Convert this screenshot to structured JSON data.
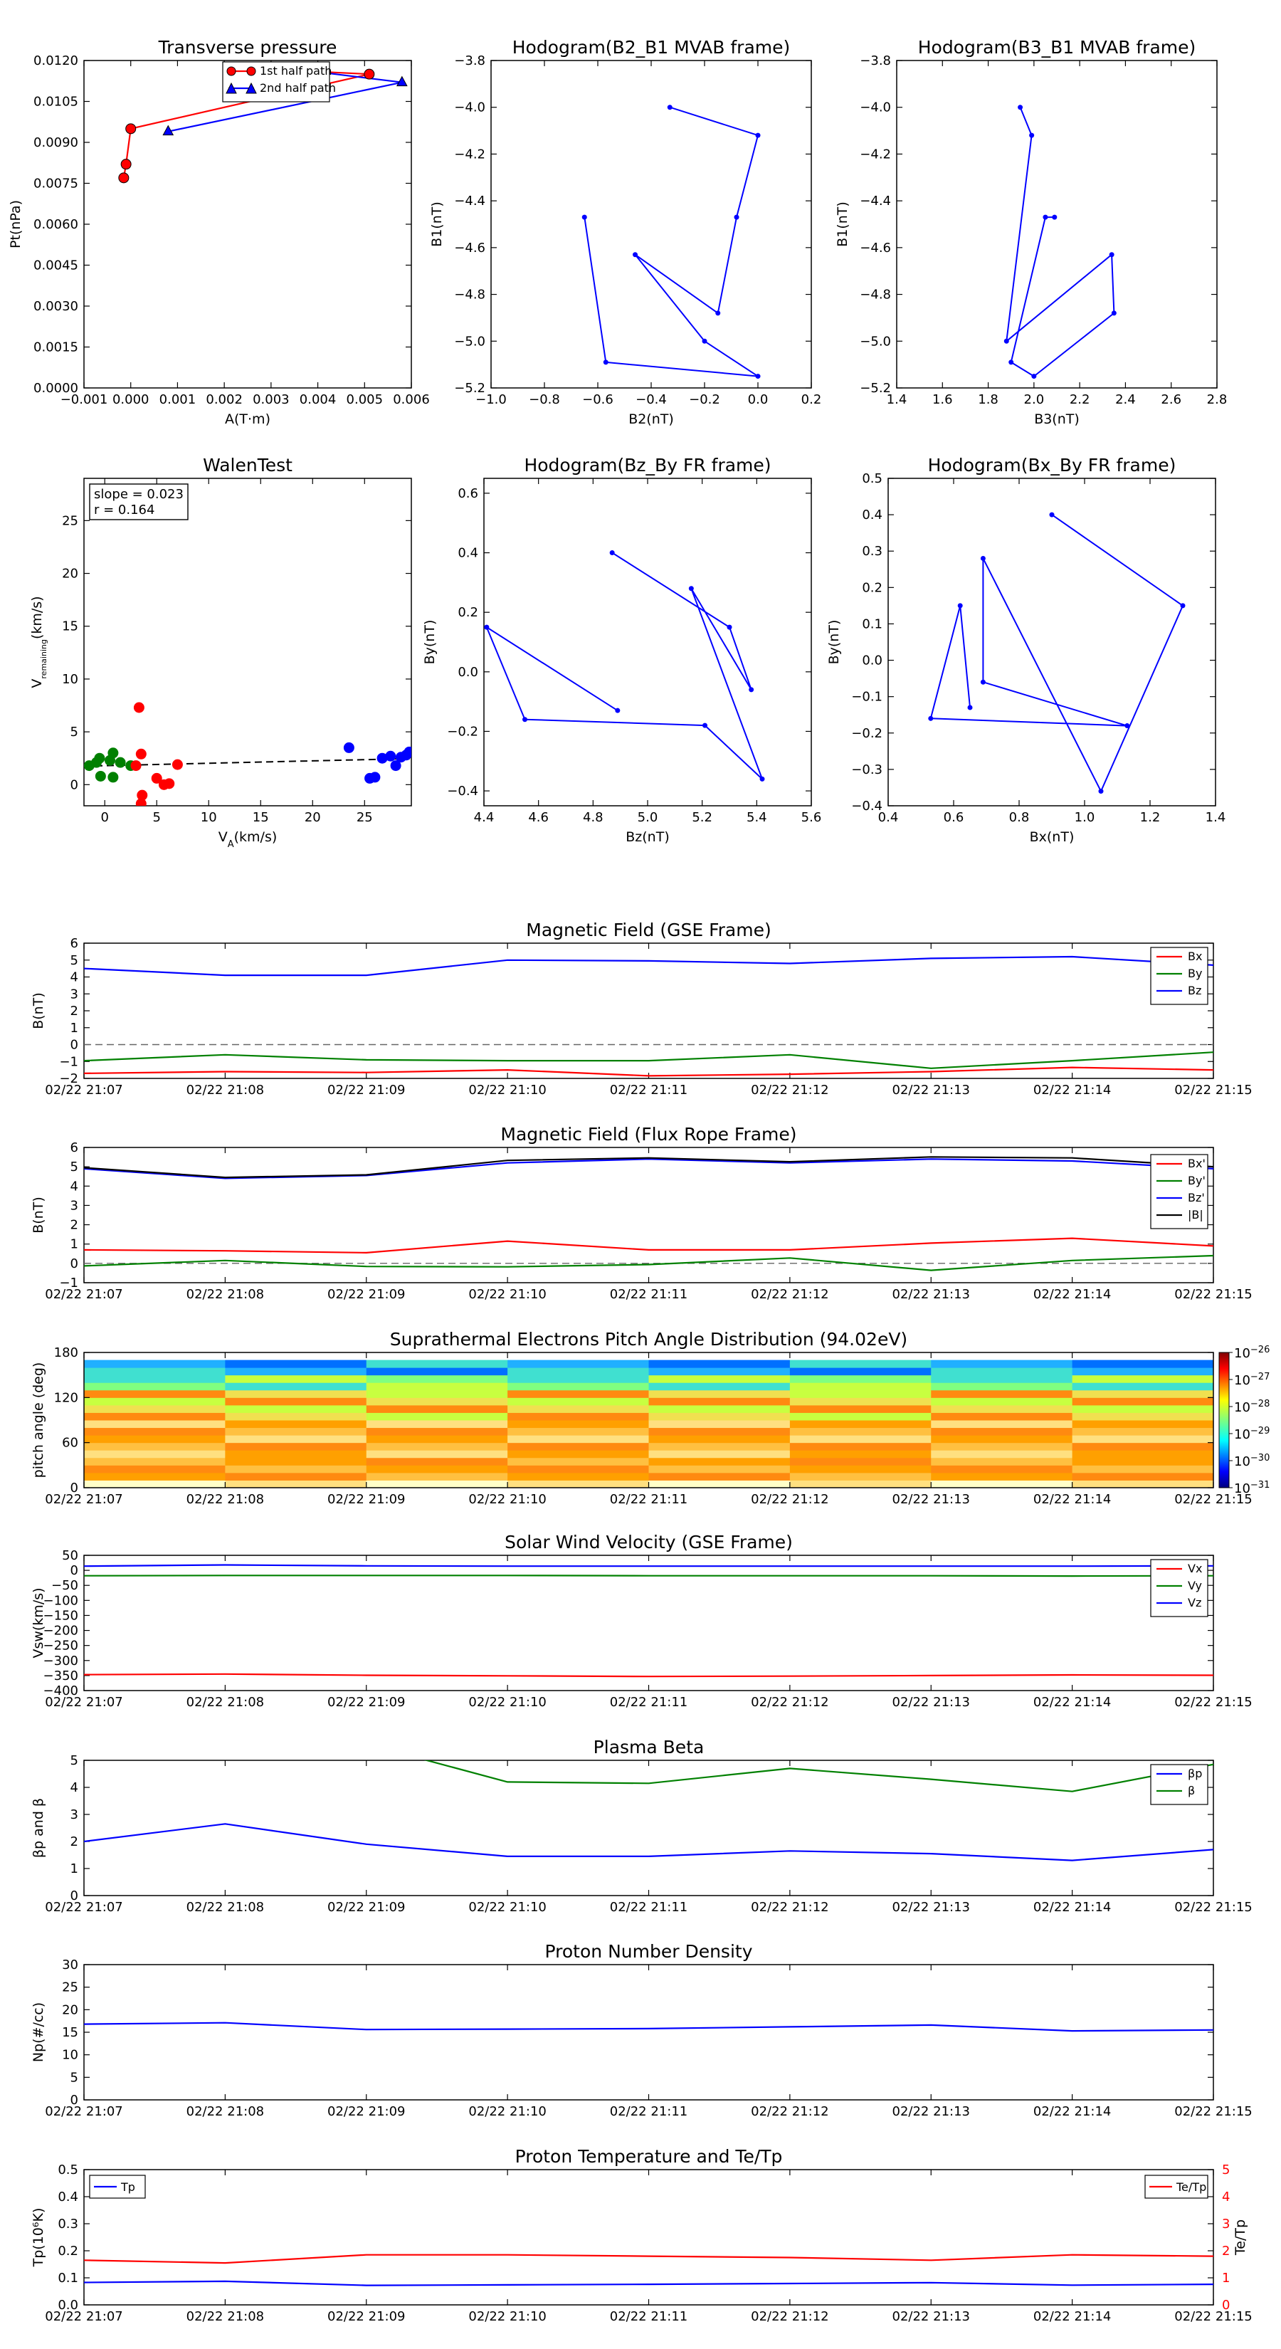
{
  "chart_data": [
    {
      "id": "pt",
      "type": "line",
      "title": "Transverse pressure",
      "xlabel": "A(T·m)",
      "ylabel": "Pt(nPa)",
      "xlim": [
        -0.001,
        0.006
      ],
      "ylim": [
        0,
        0.012
      ],
      "xticks": [
        -0.001,
        0,
        0.001,
        0.002,
        0.003,
        0.004,
        0.005,
        0.006
      ],
      "yticks": [
        0,
        0.0015,
        0.003,
        0.0045,
        0.006,
        0.0075,
        0.009,
        0.0105,
        0.012
      ],
      "xtick_labels": [
        "−0.001",
        "0.000",
        "0.001",
        "0.002",
        "0.003",
        "0.004",
        "0.005",
        "0.006"
      ],
      "ytick_labels": [
        "0.0000",
        "0.0015",
        "0.0030",
        "0.0045",
        "0.0060",
        "0.0075",
        "0.0090",
        "0.0105",
        "0.0120"
      ],
      "legend": "top-center",
      "series": [
        {
          "name": "1st half path",
          "color": "#ff0000",
          "marker": "circle",
          "x": [
            -0.00015,
            -0.0001,
            0.0,
            0.0051,
            0.0039
          ],
          "y": [
            0.0077,
            0.0082,
            0.0095,
            0.0115,
            0.0116
          ]
        },
        {
          "name": "2nd half path",
          "color": "#0000ff",
          "marker": "triangle",
          "x": [
            0.0039,
            0.0058,
            0.0008
          ],
          "y": [
            0.0116,
            0.0112,
            0.0094
          ]
        }
      ]
    },
    {
      "id": "h21",
      "type": "line",
      "title": "Hodogram(B2_B1 MVAB frame)",
      "xlabel": "B2(nT)",
      "ylabel": "B1(nT)",
      "xlim": [
        -1.0,
        0.2
      ],
      "ylim": [
        -5.2,
        -3.8
      ],
      "xticks": [
        -1.0,
        -0.8,
        -0.6,
        -0.4,
        -0.2,
        0.0,
        0.2
      ],
      "yticks": [
        -5.2,
        -5.0,
        -4.8,
        -4.6,
        -4.4,
        -4.2,
        -4.0,
        -3.8
      ],
      "xtick_labels": [
        "−1.0",
        "−0.8",
        "−0.6",
        "−0.4",
        "−0.2",
        "0.0",
        "0.2"
      ],
      "ytick_labels": [
        "−5.2",
        "−5.0",
        "−4.8",
        "−4.6",
        "−4.4",
        "−4.2",
        "−4.0",
        "−3.8"
      ],
      "series": [
        {
          "color": "#0000ff",
          "x": [
            -0.65,
            -0.57,
            0.0,
            -0.2,
            -0.46,
            -0.15,
            -0.08,
            0.0,
            -0.33
          ],
          "y": [
            -4.47,
            -5.09,
            -5.15,
            -5.0,
            -4.63,
            -4.88,
            -4.47,
            -4.12,
            -4.0
          ]
        }
      ]
    },
    {
      "id": "h31",
      "type": "line",
      "title": "Hodogram(B3_B1 MVAB frame)",
      "xlabel": "B3(nT)",
      "ylabel": "B1(nT)",
      "xlim": [
        1.4,
        2.8
      ],
      "ylim": [
        -5.2,
        -3.8
      ],
      "xticks": [
        1.4,
        1.6,
        1.8,
        2.0,
        2.2,
        2.4,
        2.6,
        2.8
      ],
      "yticks": [
        -5.2,
        -5.0,
        -4.8,
        -4.6,
        -4.4,
        -4.2,
        -4.0,
        -3.8
      ],
      "xtick_labels": [
        "1.4",
        "1.6",
        "1.8",
        "2.0",
        "2.2",
        "2.4",
        "2.6",
        "2.8"
      ],
      "ytick_labels": [
        "−5.2",
        "−5.0",
        "−4.8",
        "−4.6",
        "−4.4",
        "−4.2",
        "−4.0",
        "−3.8"
      ],
      "series": [
        {
          "color": "#0000ff",
          "x": [
            2.09,
            2.05,
            1.9,
            2.0,
            2.35,
            2.34,
            1.88,
            1.99,
            1.94
          ],
          "y": [
            -4.47,
            -4.47,
            -5.09,
            -5.15,
            -4.88,
            -4.63,
            -5.0,
            -4.12,
            -4.0
          ]
        }
      ]
    },
    {
      "id": "walen",
      "type": "scatter",
      "title": "WalenTest",
      "xlabel": "V",
      "xlabel_sub": "A",
      "xlabel_unit": "(km/s)",
      "ylabel": "V",
      "ylabel_sub": "remaining",
      "ylabel_unit": "(km/s)",
      "xlim": [
        -2,
        29.5
      ],
      "ylim": [
        -2,
        29
      ],
      "xticks": [
        0,
        5,
        10,
        15,
        20,
        25
      ],
      "yticks": [
        0,
        5,
        10,
        15,
        20,
        25
      ],
      "xtick_labels": [
        "0",
        "5",
        "10",
        "15",
        "20",
        "25"
      ],
      "ytick_labels": [
        "0",
        "5",
        "10",
        "15",
        "20",
        "25"
      ],
      "annotation": [
        "slope = 0.023",
        "r = 0.164"
      ],
      "fit": {
        "x": [
          -2,
          29.5
        ],
        "y": [
          1.75,
          2.47
        ]
      },
      "groups": [
        {
          "color": "#008000",
          "x": [
            -1.5,
            -0.8,
            -0.5,
            0.5,
            0.8,
            1.5,
            2.5,
            -0.4,
            0.8
          ],
          "y": [
            1.8,
            2.1,
            2.5,
            2.3,
            3.0,
            2.1,
            1.8,
            0.8,
            0.7
          ]
        },
        {
          "color": "#ff0000",
          "x": [
            3.3,
            3.5,
            3.6,
            3.5,
            5.0,
            5.7,
            6.2,
            7.0,
            3.0
          ],
          "y": [
            7.3,
            2.9,
            -1.0,
            -1.8,
            0.6,
            0.0,
            0.1,
            1.9,
            1.8
          ]
        },
        {
          "color": "#0000ff",
          "x": [
            23.5,
            25.5,
            26.0,
            26.7,
            27.5,
            28.0,
            28.5,
            29.0,
            29.3
          ],
          "y": [
            3.5,
            0.6,
            0.7,
            2.5,
            2.7,
            1.8,
            2.6,
            2.8,
            3.1
          ]
        }
      ]
    },
    {
      "id": "hzy",
      "type": "line",
      "title": "Hodogram(Bz_By FR frame)",
      "xlabel": "Bz(nT)",
      "ylabel": "By(nT)",
      "xlim": [
        4.4,
        5.6
      ],
      "ylim": [
        -0.45,
        0.65
      ],
      "xticks": [
        4.4,
        4.6,
        4.8,
        5.0,
        5.2,
        5.4,
        5.6
      ],
      "yticks": [
        -0.4,
        -0.2,
        0.0,
        0.2,
        0.4,
        0.6
      ],
      "xtick_labels": [
        "4.4",
        "4.6",
        "4.8",
        "5.0",
        "5.2",
        "5.4",
        "5.6"
      ],
      "ytick_labels": [
        "−0.4",
        "−0.2",
        "0.0",
        "0.2",
        "0.4",
        "0.6"
      ],
      "series": [
        {
          "color": "#0000ff",
          "x": [
            4.87,
            5.3,
            5.38,
            5.16,
            5.42,
            5.21,
            4.55,
            4.41,
            4.89
          ],
          "y": [
            0.4,
            0.15,
            -0.06,
            0.28,
            -0.36,
            -0.18,
            -0.16,
            0.15,
            -0.13
          ]
        }
      ]
    },
    {
      "id": "hxy",
      "type": "line",
      "title": "Hodogram(Bx_By FR frame)",
      "xlabel": "Bx(nT)",
      "ylabel": "By(nT)",
      "xlim": [
        0.4,
        1.4
      ],
      "ylim": [
        -0.4,
        0.5
      ],
      "xticks": [
        0.4,
        0.6,
        0.8,
        1.0,
        1.2,
        1.4
      ],
      "yticks": [
        -0.4,
        -0.3,
        -0.2,
        -0.1,
        0.0,
        0.1,
        0.2,
        0.3,
        0.4,
        0.5
      ],
      "xtick_labels": [
        "0.4",
        "0.6",
        "0.8",
        "1.0",
        "1.2",
        "1.4"
      ],
      "ytick_labels": [
        "−0.4",
        "−0.3",
        "−0.2",
        "−0.1",
        "0.0",
        "0.1",
        "0.2",
        "0.3",
        "0.4",
        "0.5"
      ],
      "series": [
        {
          "color": "#0000ff",
          "x": [
            0.9,
            1.3,
            1.05,
            0.69,
            0.69,
            1.13,
            0.53,
            0.62,
            0.65
          ],
          "y": [
            0.4,
            0.15,
            -0.36,
            0.28,
            -0.06,
            -0.18,
            -0.16,
            0.15,
            -0.13
          ]
        }
      ]
    },
    {
      "id": "bgse",
      "type": "line",
      "title": "Magnetic Field (GSE Frame)",
      "ylabel": "B(nT)",
      "x": [
        0,
        1,
        2,
        3,
        4,
        5,
        6,
        7,
        8
      ],
      "xtick_labels": [
        "02/22 21:07",
        "02/22 21:08",
        "02/22 21:09",
        "02/22 21:10",
        "02/22 21:11",
        "02/22 21:12",
        "02/22 21:13",
        "02/22 21:14",
        "02/22 21:15"
      ],
      "ylim": [
        -2,
        6
      ],
      "yticks": [
        -2,
        -1,
        0,
        1,
        2,
        3,
        4,
        5,
        6
      ],
      "ytick_labels": [
        "−2",
        "−1",
        "0",
        "1",
        "2",
        "3",
        "4",
        "5",
        "6"
      ],
      "zero_line": true,
      "legend": "top-right",
      "series": [
        {
          "name": "Bx",
          "color": "#ff0000",
          "values": [
            -1.7,
            -1.6,
            -1.65,
            -1.5,
            -1.85,
            -1.75,
            -1.6,
            -1.35,
            -1.5
          ]
        },
        {
          "name": "By",
          "color": "#008000",
          "values": [
            -0.95,
            -0.6,
            -0.9,
            -0.95,
            -0.95,
            -0.6,
            -1.4,
            -0.95,
            -0.45
          ]
        },
        {
          "name": "Bz",
          "color": "#0000ff",
          "values": [
            4.5,
            4.1,
            4.1,
            5.0,
            4.95,
            4.8,
            5.1,
            5.2,
            4.7
          ]
        }
      ]
    },
    {
      "id": "bfr",
      "type": "line",
      "title": "Magnetic Field (Flux Rope Frame)",
      "ylabel": "B(nT)",
      "x": [
        0,
        1,
        2,
        3,
        4,
        5,
        6,
        7,
        8
      ],
      "xtick_labels": [
        "02/22 21:07",
        "02/22 21:08",
        "02/22 21:09",
        "02/22 21:10",
        "02/22 21:11",
        "02/22 21:12",
        "02/22 21:13",
        "02/22 21:14",
        "02/22 21:15"
      ],
      "ylim": [
        -1,
        6
      ],
      "yticks": [
        -1,
        0,
        1,
        2,
        3,
        4,
        5,
        6
      ],
      "ytick_labels": [
        "−1",
        "0",
        "1",
        "2",
        "3",
        "4",
        "5",
        "6"
      ],
      "zero_line": true,
      "legend": "right",
      "series": [
        {
          "name": "Bx'",
          "color": "#ff0000",
          "values": [
            0.7,
            0.65,
            0.55,
            1.15,
            0.7,
            0.7,
            1.05,
            1.3,
            0.9
          ]
        },
        {
          "name": "By'",
          "color": "#008000",
          "values": [
            -0.13,
            0.15,
            -0.16,
            -0.18,
            -0.06,
            0.28,
            -0.36,
            0.15,
            0.4
          ]
        },
        {
          "name": "Bz'",
          "color": "#0000ff",
          "values": [
            4.9,
            4.4,
            4.55,
            5.2,
            5.4,
            5.2,
            5.4,
            5.3,
            4.9
          ]
        },
        {
          "name": "|B|",
          "color": "#000000",
          "values": [
            4.95,
            4.45,
            4.58,
            5.33,
            5.46,
            5.26,
            5.51,
            5.46,
            5.0
          ]
        }
      ]
    },
    {
      "id": "pad",
      "type": "heatmap",
      "title": "Suprathermal Electrons Pitch Angle Distribution (94.02eV)",
      "ylabel": "pitch angle (deg)",
      "x": [
        0,
        1,
        2,
        3,
        4,
        5,
        6,
        7,
        8
      ],
      "xtick_labels": [
        "02/22 21:07",
        "02/22 21:08",
        "02/22 21:09",
        "02/22 21:10",
        "02/22 21:11",
        "02/22 21:12",
        "02/22 21:13",
        "02/22 21:14",
        "02/22 21:15"
      ],
      "ylim": [
        0,
        180
      ],
      "yticks": [
        0,
        60,
        120,
        180
      ],
      "ytick_labels": [
        "0",
        "60",
        "120",
        "180"
      ],
      "colorbar": {
        "exponents": [
          -26,
          -27,
          -28,
          -29,
          -30,
          -31
        ],
        "base": "10"
      }
    },
    {
      "id": "vsw",
      "type": "line",
      "title": "Solar Wind Velocity (GSE Frame)",
      "ylabel": "Vsw(km/s)",
      "x": [
        0,
        1,
        2,
        3,
        4,
        5,
        6,
        7,
        8
      ],
      "xtick_labels": [
        "02/22 21:07",
        "02/22 21:08",
        "02/22 21:09",
        "02/22 21:10",
        "02/22 21:11",
        "02/22 21:12",
        "02/22 21:13",
        "02/22 21:14",
        "02/22 21:15"
      ],
      "ylim": [
        -400,
        50
      ],
      "yticks": [
        -400,
        -350,
        -300,
        -250,
        -200,
        -150,
        -100,
        -50,
        0,
        50
      ],
      "ytick_labels": [
        "−400",
        "−350",
        "−300",
        "−250",
        "−200",
        "−150",
        "−100",
        "−50",
        "0",
        "50"
      ],
      "legend": "top-right",
      "series": [
        {
          "name": "Vx",
          "color": "#ff0000",
          "values": [
            -347,
            -345,
            -349,
            -351,
            -353,
            -352,
            -350,
            -348,
            -349
          ]
        },
        {
          "name": "Vy",
          "color": "#008000",
          "values": [
            -18,
            -17,
            -17,
            -17,
            -18,
            -18,
            -18,
            -19,
            -18
          ]
        },
        {
          "name": "Vz",
          "color": "#0000ff",
          "values": [
            14,
            18,
            15,
            14,
            14,
            14,
            14,
            14,
            15
          ]
        }
      ]
    },
    {
      "id": "beta",
      "type": "line",
      "title": "Plasma Beta",
      "ylabel": "βp and β",
      "x": [
        0,
        1,
        2,
        3,
        4,
        5,
        6,
        7,
        8
      ],
      "xtick_labels": [
        "02/22 21:07",
        "02/22 21:08",
        "02/22 21:09",
        "02/22 21:10",
        "02/22 21:11",
        "02/22 21:12",
        "02/22 21:13",
        "02/22 21:14",
        "02/22 21:15"
      ],
      "ylim": [
        0,
        5
      ],
      "yticks": [
        0,
        1,
        2,
        3,
        4,
        5
      ],
      "ytick_labels": [
        "0",
        "1",
        "2",
        "3",
        "4",
        "5"
      ],
      "legend": "top-right",
      "series": [
        {
          "name": "βp",
          "color": "#0000ff",
          "values": [
            2.0,
            2.65,
            1.9,
            1.45,
            1.45,
            1.65,
            1.55,
            1.3,
            1.7
          ]
        },
        {
          "name": "β",
          "color": "#008000",
          "values": [
            5.9,
            6.4,
            5.6,
            4.2,
            4.15,
            4.7,
            4.3,
            3.85,
            4.85
          ]
        }
      ]
    },
    {
      "id": "np",
      "type": "line",
      "title": "Proton Number Density",
      "ylabel": "Np(#/cc)",
      "x": [
        0,
        1,
        2,
        3,
        4,
        5,
        6,
        7,
        8
      ],
      "xtick_labels": [
        "02/22 21:07",
        "02/22 21:08",
        "02/22 21:09",
        "02/22 21:10",
        "02/22 21:11",
        "02/22 21:12",
        "02/22 21:13",
        "02/22 21:14",
        "02/22 21:15"
      ],
      "ylim": [
        0,
        30
      ],
      "yticks": [
        0,
        5,
        10,
        15,
        20,
        25,
        30
      ],
      "ytick_labels": [
        "0",
        "5",
        "10",
        "15",
        "20",
        "25",
        "30"
      ],
      "series": [
        {
          "color": "#0000ff",
          "values": [
            16.8,
            17.1,
            15.6,
            15.7,
            15.8,
            16.2,
            16.6,
            15.3,
            15.5
          ]
        }
      ]
    },
    {
      "id": "tp",
      "type": "line",
      "title": "Proton Temperature and Te/Tp",
      "ylabel": "Tp(10⁶K)",
      "y2label": "Te/Tp",
      "x": [
        0,
        1,
        2,
        3,
        4,
        5,
        6,
        7,
        8
      ],
      "xtick_labels": [
        "02/22 21:07",
        "02/22 21:08",
        "02/22 21:09",
        "02/22 21:10",
        "02/22 21:11",
        "02/22 21:12",
        "02/22 21:13",
        "02/22 21:14",
        "02/22 21:15"
      ],
      "ylim": [
        0,
        0.5
      ],
      "yticks": [
        0,
        0.1,
        0.2,
        0.3,
        0.4,
        0.5
      ],
      "ytick_labels": [
        "0.0",
        "0.1",
        "0.2",
        "0.3",
        "0.4",
        "0.5"
      ],
      "y2lim": [
        0,
        5
      ],
      "y2ticks": [
        0,
        1,
        2,
        3,
        4,
        5
      ],
      "y2tick_labels": [
        "0",
        "1",
        "2",
        "3",
        "4",
        "5"
      ],
      "series": [
        {
          "name": "Tp",
          "color": "#0000ff",
          "axis": "left",
          "values": [
            0.083,
            0.087,
            0.072,
            0.074,
            0.076,
            0.079,
            0.082,
            0.073,
            0.076
          ]
        },
        {
          "name": "Te/Tp",
          "color": "#ff0000",
          "axis": "right",
          "values": [
            1.65,
            1.55,
            1.85,
            1.85,
            1.8,
            1.75,
            1.65,
            1.85,
            1.8
          ]
        }
      ]
    }
  ]
}
